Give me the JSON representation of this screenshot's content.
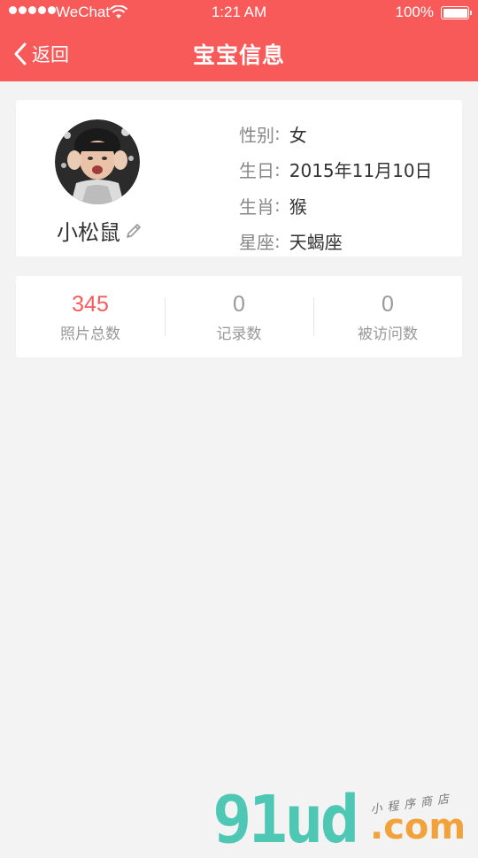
{
  "status_bar": {
    "carrier": "WeChat",
    "time": "1:21 AM",
    "battery": "100%"
  },
  "nav": {
    "back_label": "返回",
    "title": "宝宝信息"
  },
  "profile": {
    "nickname": "小松鼠",
    "fields": [
      {
        "label": "性别",
        "value": "女"
      },
      {
        "label": "生日",
        "value": "2015年11月10日"
      },
      {
        "label": "生肖",
        "value": "猴"
      },
      {
        "label": "星座",
        "value": "天蝎座"
      }
    ]
  },
  "stats": [
    {
      "value": "345",
      "label": "照片总数"
    },
    {
      "value": "0",
      "label": "记录数"
    },
    {
      "value": "0",
      "label": "被访问数"
    }
  ],
  "watermark": {
    "main": "91ud",
    "suffix": ".com",
    "tagline": "小程序商店"
  },
  "colors": {
    "accent": "#f85a5a",
    "background": "#f3f3f3"
  }
}
